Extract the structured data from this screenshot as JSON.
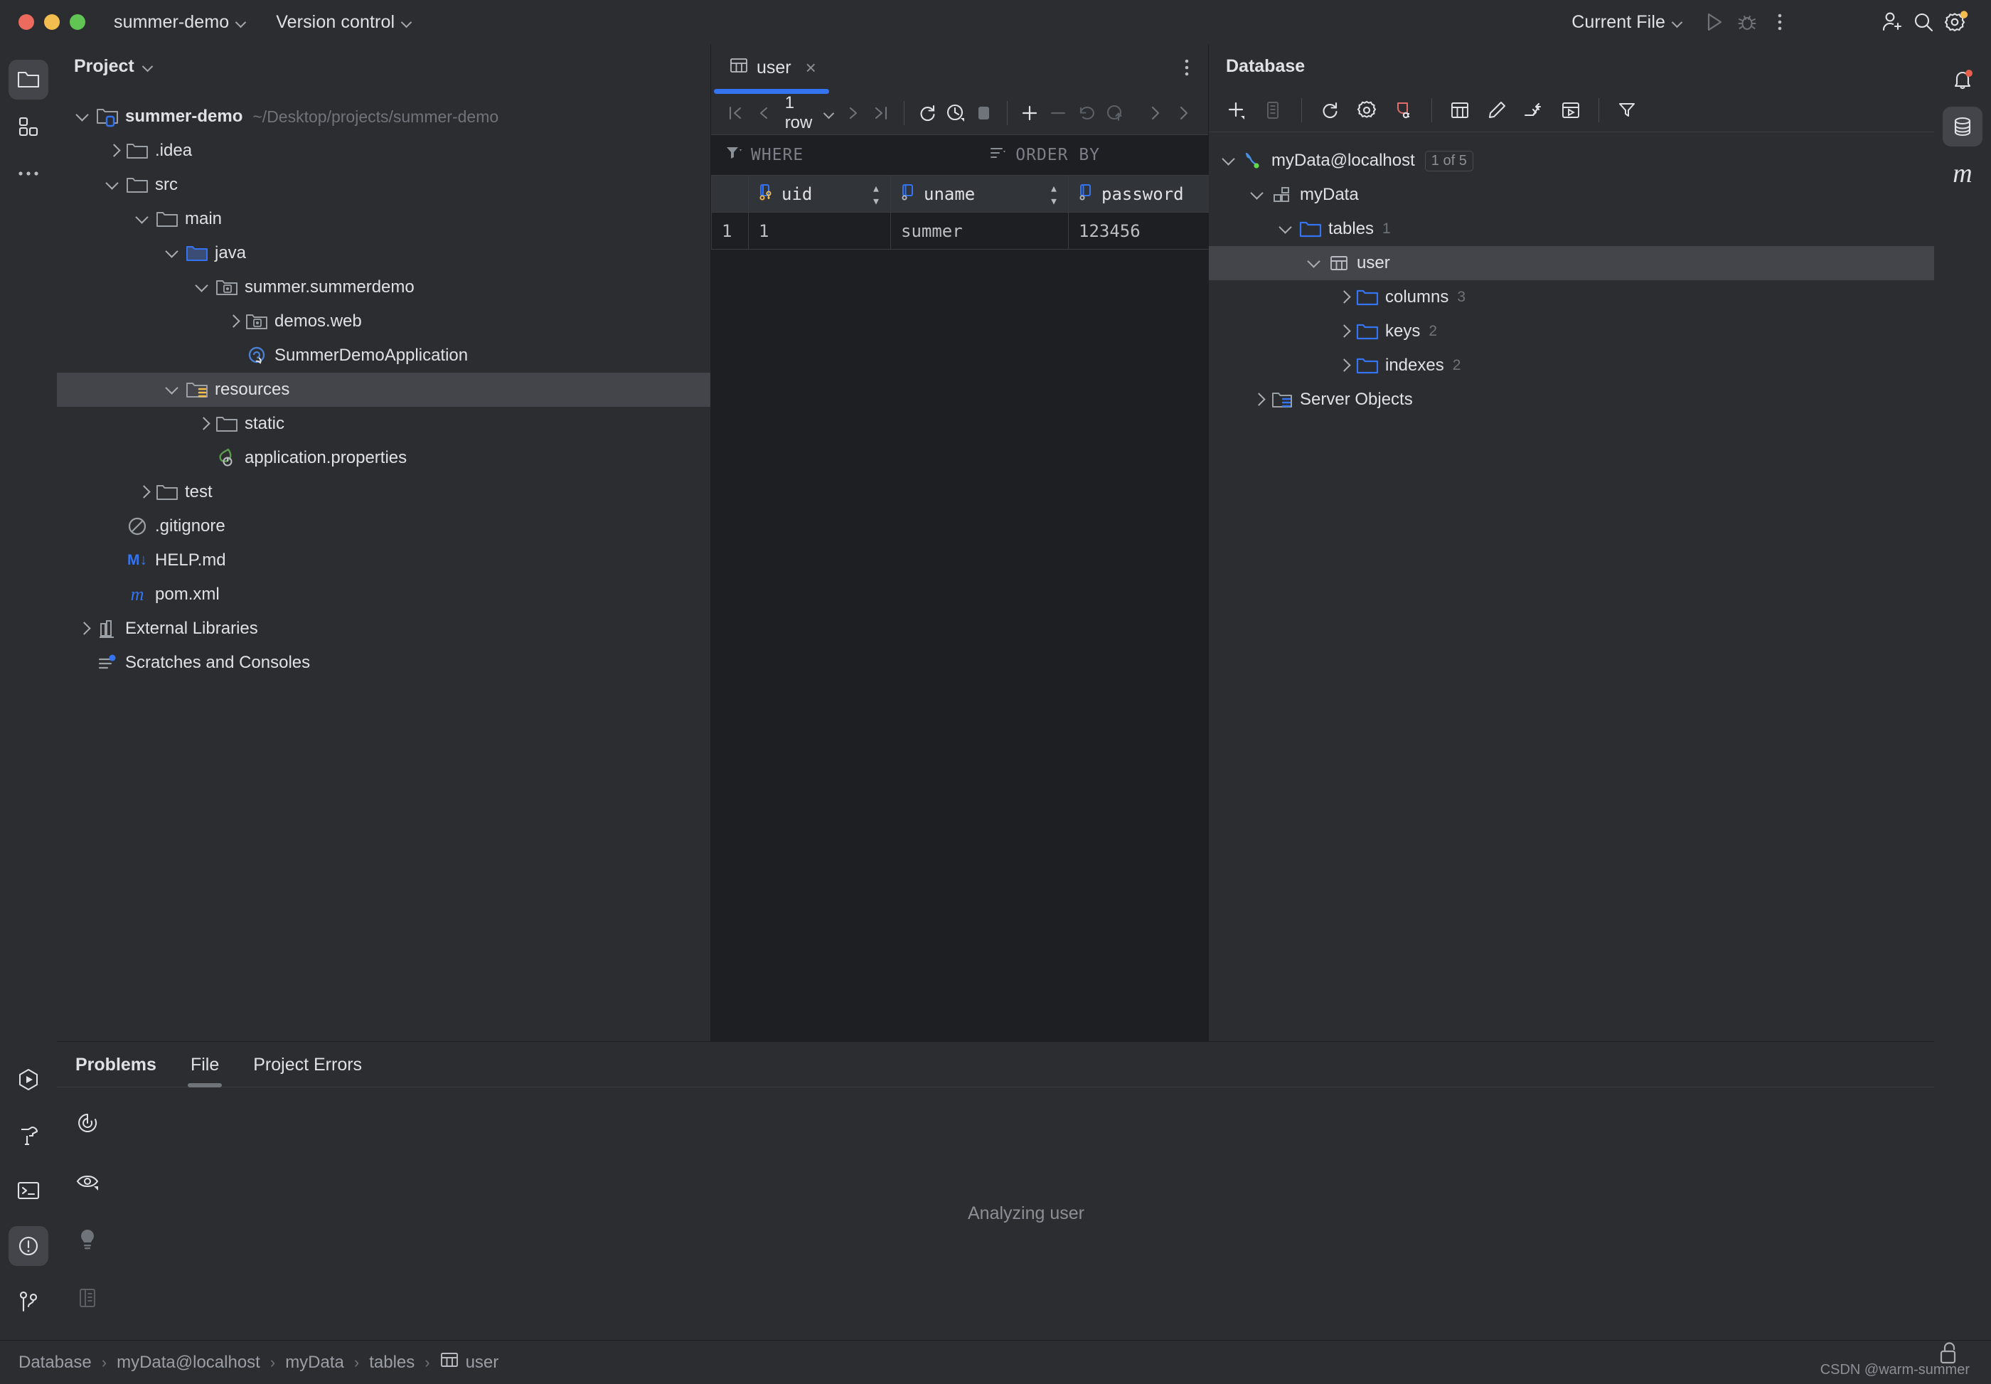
{
  "titlebar": {
    "project_name": "summer-demo",
    "version_control": "Version control",
    "run_config": "Current File",
    "icons": {
      "run": "run-icon",
      "debug": "debug-icon",
      "more": "more-actions-icon",
      "add_user": "add-user-icon",
      "search": "search-icon",
      "settings": "settings-icon"
    }
  },
  "left_stripe": [
    {
      "name": "project-tool-window",
      "icon": "folder-icon",
      "active": true
    },
    {
      "name": "structure-tool-window",
      "icon": "grid-blocks-icon",
      "active": false
    },
    {
      "name": "more-tool-windows",
      "icon": "ellipsis-icon",
      "active": false
    }
  ],
  "left_stripe_bottom": [
    {
      "name": "run-tool-window",
      "icon": "run-hex-icon",
      "active": false
    },
    {
      "name": "build-tool-window",
      "icon": "hammer-icon",
      "active": false
    },
    {
      "name": "terminal-tool-window",
      "icon": "terminal-icon",
      "active": false
    },
    {
      "name": "problems-tool-window",
      "icon": "warning-circle-icon",
      "active": true
    },
    {
      "name": "version-control-tool-window",
      "icon": "branch-icon",
      "active": false
    }
  ],
  "right_stripe": [
    {
      "name": "notifications-tool-window",
      "icon": "bell-icon",
      "active": false,
      "badge": true
    },
    {
      "name": "database-tool-window",
      "icon": "database-icon",
      "active": true
    },
    {
      "name": "maven-tool-window",
      "icon": "maven-m-icon",
      "active": false
    }
  ],
  "project_panel": {
    "title": "Project",
    "tree": [
      {
        "label": "summer-demo",
        "secondary": "~/Desktop/projects/summer-demo",
        "depth": 0,
        "arrow": "down",
        "icon": "module-folder-icon",
        "bold": true,
        "selected": false
      },
      {
        "label": ".idea",
        "depth": 1,
        "arrow": "right",
        "icon": "folder-icon",
        "selected": false
      },
      {
        "label": "src",
        "depth": 1,
        "arrow": "down",
        "icon": "folder-icon",
        "selected": false
      },
      {
        "label": "main",
        "depth": 2,
        "arrow": "down",
        "icon": "folder-icon",
        "selected": false
      },
      {
        "label": "java",
        "depth": 3,
        "arrow": "down",
        "icon": "source-folder-icon",
        "selected": false
      },
      {
        "label": "summer.summerdemo",
        "depth": 4,
        "arrow": "down",
        "icon": "package-icon",
        "selected": false
      },
      {
        "label": "demos.web",
        "depth": 5,
        "arrow": "right",
        "icon": "package-icon",
        "selected": false
      },
      {
        "label": "SummerDemoApplication",
        "depth": 5,
        "arrow": "none",
        "icon": "spring-class-icon",
        "selected": false
      },
      {
        "label": "resources",
        "depth": 3,
        "arrow": "down",
        "icon": "resources-folder-icon",
        "selected": true
      },
      {
        "label": "static",
        "depth": 4,
        "arrow": "right",
        "icon": "folder-icon",
        "selected": false
      },
      {
        "label": "application.properties",
        "depth": 4,
        "arrow": "none",
        "icon": "spring-properties-icon",
        "selected": false
      },
      {
        "label": "test",
        "depth": 2,
        "arrow": "right",
        "icon": "folder-icon",
        "selected": false
      },
      {
        "label": ".gitignore",
        "depth": 1,
        "arrow": "none",
        "icon": "gitignore-icon",
        "selected": false
      },
      {
        "label": "HELP.md",
        "depth": 1,
        "arrow": "none",
        "icon": "markdown-icon",
        "selected": false
      },
      {
        "label": "pom.xml",
        "depth": 1,
        "arrow": "none",
        "icon": "maven-m-icon",
        "selected": false
      },
      {
        "label": "External Libraries",
        "depth": 0,
        "arrow": "right",
        "icon": "libraries-icon",
        "selected": false
      },
      {
        "label": "Scratches and Consoles",
        "depth": 0,
        "arrow": "none",
        "icon": "scratches-icon",
        "selected": false
      }
    ]
  },
  "editor": {
    "tab": {
      "label": "user",
      "icon": "table-icon",
      "close": "×"
    },
    "kebab": "more-options-icon",
    "toolbar": {
      "first_page": "first-page-icon",
      "prev_page": "prev-page-icon",
      "row_count": "1 row",
      "next_page": "next-page-icon",
      "last_page": "last-page-icon",
      "reload": "reload-icon",
      "history": "history-icon",
      "stop": "stop-icon",
      "add_row": "add-row-icon",
      "delete_row": "delete-row-icon",
      "revert": "revert-icon",
      "submit": "submit-icon",
      "expand": "expand-icon",
      "more": "more-icon"
    },
    "filterbar": {
      "where": "WHERE",
      "order_by": "ORDER BY"
    },
    "grid": {
      "columns": [
        {
          "name": "uid",
          "icon": "primary-key-column-icon"
        },
        {
          "name": "uname",
          "icon": "column-icon"
        },
        {
          "name": "password",
          "icon": "column-icon"
        }
      ],
      "rows": [
        {
          "num": "1",
          "cells": [
            "1",
            "summer",
            "123456"
          ]
        }
      ]
    }
  },
  "database_panel": {
    "title": "Database",
    "toolbar": [
      {
        "name": "new-data-source-button",
        "icon": "plus-icon"
      },
      {
        "name": "duplicate-button",
        "icon": "copy-icon"
      },
      {
        "name": "refresh-button",
        "icon": "refresh-icon"
      },
      {
        "name": "data-source-properties-button",
        "icon": "gear-icon"
      },
      {
        "name": "disconnect-button",
        "icon": "disconnect-icon"
      },
      {
        "name": "open-table-editor-button",
        "icon": "table-icon"
      },
      {
        "name": "modify-object-button",
        "icon": "pencil-icon"
      },
      {
        "name": "jump-to-query-console-button",
        "icon": "jump-icon"
      },
      {
        "name": "open-console-button",
        "icon": "console-icon"
      },
      {
        "name": "filter-button",
        "icon": "filter-icon"
      }
    ],
    "tree": [
      {
        "label": "myData@localhost",
        "badge": "1 of 5",
        "depth": 0,
        "arrow": "down",
        "icon": "mysql-icon",
        "selected": false
      },
      {
        "label": "myData",
        "depth": 1,
        "arrow": "down",
        "icon": "schema-icon",
        "selected": false
      },
      {
        "label": "tables",
        "count": "1",
        "depth": 2,
        "arrow": "down",
        "icon": "db-folder-icon",
        "selected": false
      },
      {
        "label": "user",
        "depth": 3,
        "arrow": "down",
        "icon": "table-icon",
        "selected": true
      },
      {
        "label": "columns",
        "count": "3",
        "depth": 4,
        "arrow": "right",
        "icon": "db-folder-icon",
        "selected": false
      },
      {
        "label": "keys",
        "count": "2",
        "depth": 4,
        "arrow": "right",
        "icon": "db-folder-icon",
        "selected": false
      },
      {
        "label": "indexes",
        "count": "2",
        "depth": 4,
        "arrow": "right",
        "icon": "db-folder-icon",
        "selected": false
      },
      {
        "label": "Server Objects",
        "depth": 1,
        "arrow": "right",
        "icon": "server-objects-icon",
        "selected": false
      }
    ]
  },
  "problems_panel": {
    "title": "Problems",
    "tabs": [
      {
        "label": "File",
        "selected": true
      },
      {
        "label": "Project Errors",
        "selected": false
      }
    ],
    "gutter": [
      {
        "name": "rerun-inspections-button",
        "icon": "rerun-icon"
      },
      {
        "name": "view-options-button",
        "icon": "eye-icon"
      },
      {
        "name": "show-quick-fixes-button",
        "icon": "lightbulb-icon"
      },
      {
        "name": "preview-button",
        "icon": "preview-panel-icon"
      }
    ],
    "status": "Analyzing user"
  },
  "statusbar": {
    "breadcrumbs": [
      {
        "label": "Database",
        "icon": null
      },
      {
        "label": "myData@localhost",
        "icon": null
      },
      {
        "label": "myData",
        "icon": null
      },
      {
        "label": "tables",
        "icon": null
      },
      {
        "label": "user",
        "icon": "table-icon"
      }
    ],
    "separator": "›",
    "watermark": "CSDN @warm-summer"
  },
  "colors": {
    "accent_blue": "#3574f0",
    "panel_bg": "#2b2d30",
    "editor_bg": "#1e1f22",
    "selection": "#43454a",
    "text": "#dfe1e5",
    "muted": "#6f737a",
    "mysql_blue": "#4a90e2",
    "connected_green": "#62d84e",
    "warn_yellow": "#f4bd4f",
    "notify_red": "#e8604c",
    "folder_blue": "#3574f0"
  }
}
